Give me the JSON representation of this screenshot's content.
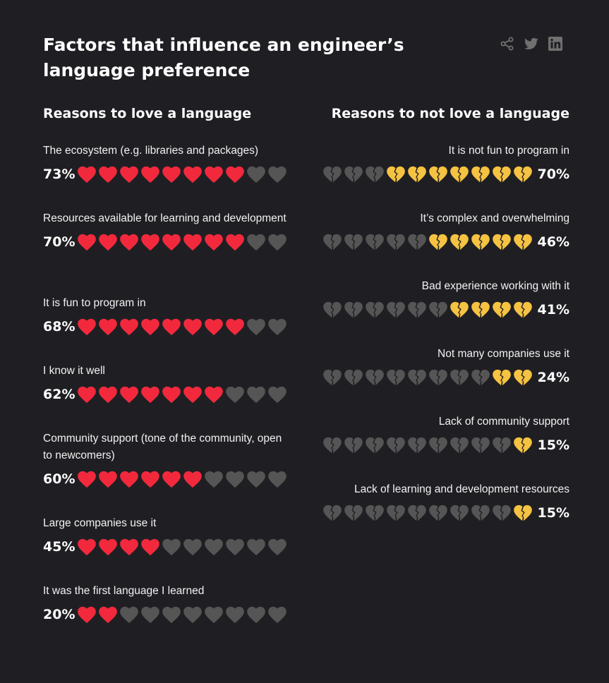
{
  "title": "Factors that influence an engineer’s language preference",
  "colors": {
    "love": "#f2293d",
    "not_love": "#f5c242",
    "inactive": "#555555",
    "background": "#1f1f23",
    "share_icons": "#707070"
  },
  "share": [
    "share-icon",
    "twitter-icon",
    "linkedin-icon"
  ],
  "chart_data": [
    {
      "type": "table",
      "title": "Reasons to love a language",
      "icon": "heart",
      "categories": [
        "The ecosystem (e.g. libraries and packages)",
        "Resources available for learning and development",
        "It is fun to program in",
        "I know it well",
        "Community support (tone of the community, open to newcomers)",
        "Large companies use it",
        "It was the first language I learned"
      ],
      "labels": [
        "73%",
        "70%",
        "68%",
        "62%",
        "60%",
        "45%",
        "20%"
      ],
      "values": [
        73,
        70,
        68,
        62,
        60,
        45,
        20
      ],
      "filled_icons": [
        8,
        8,
        8,
        7,
        6,
        4,
        2
      ],
      "total_icons": 10
    },
    {
      "type": "table",
      "title": "Reasons to not love a language",
      "icon": "broken-heart",
      "categories": [
        "It is not fun to program in",
        "It’s complex and overwhelming",
        "Bad experience working with it",
        "Not many companies use it",
        "Lack of community support",
        "Lack of learning and development resources"
      ],
      "labels": [
        "70%",
        "46%",
        "41%",
        "24%",
        "15%",
        "15%"
      ],
      "values": [
        70,
        46,
        41,
        24,
        15,
        15
      ],
      "filled_icons": [
        7,
        5,
        4,
        2,
        1,
        1
      ],
      "total_icons": 10
    }
  ]
}
